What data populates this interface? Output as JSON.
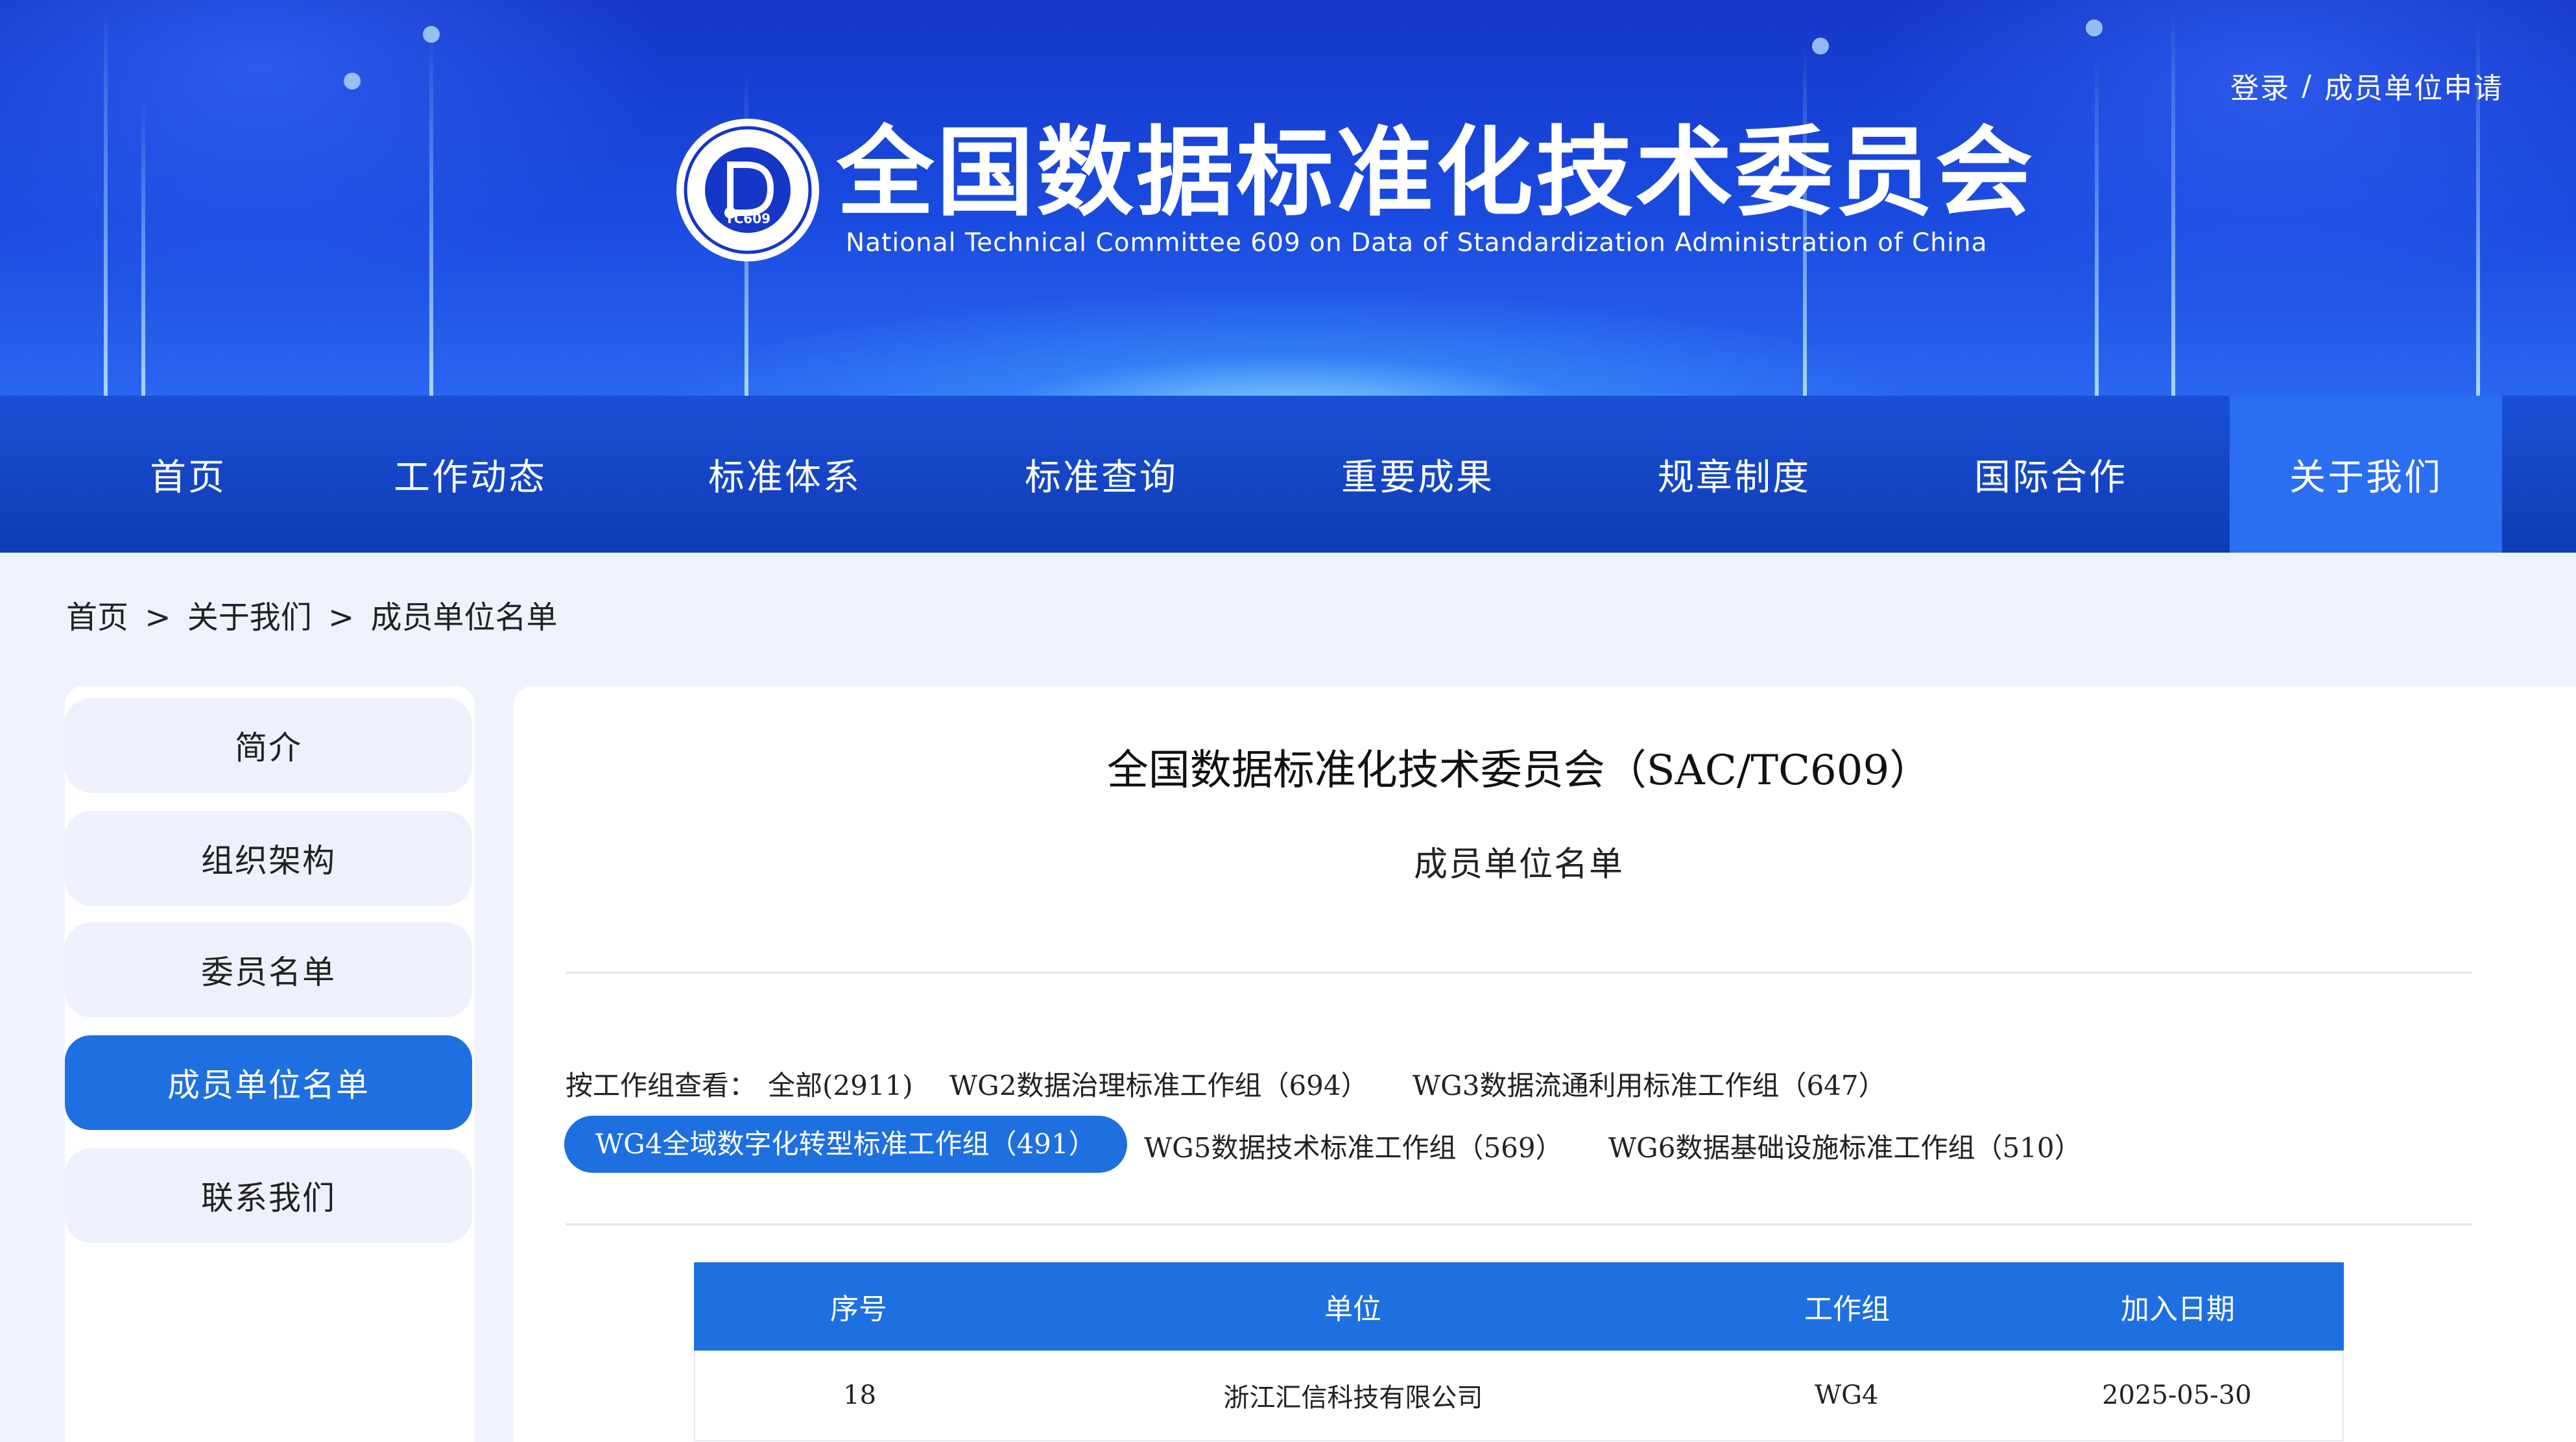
{
  "header": {
    "site_title": "全国数据标准化技术委员会",
    "site_subtitle": "National Technical Committee 609 on Data of Standardization Administration of China",
    "login_link": "登录",
    "link_separator": "/",
    "apply_link": "成员单位申请",
    "seal_badge": "TC609"
  },
  "nav": {
    "items": [
      "首页",
      "工作动态",
      "标准体系",
      "标准查询",
      "重要成果",
      "规章制度",
      "国际合作",
      "关于我们"
    ],
    "active": "关于我们"
  },
  "breadcrumb": {
    "home": "首页",
    "sep": ">",
    "parent": "关于我们",
    "current": "成员单位名单"
  },
  "sidebar": {
    "items": [
      "简介",
      "组织架构",
      "委员名单",
      "成员单位名单",
      "联系我们"
    ],
    "active": "成员单位名单"
  },
  "main": {
    "title": "全国数据标准化技术委员会（SAC/TC609）",
    "subtitle": "成员单位名单",
    "filter_label": "按工作组查看：",
    "filters": [
      "全部(2911)",
      "WG2数据治理标准工作组（694）",
      "WG3数据流通利用标准工作组（647）",
      "WG4全域数字化转型标准工作组（491）",
      "WG5数据技术标准工作组（569）",
      "WG6数据基础设施标准工作组（510）"
    ],
    "active_filter": "WG4全域数字化转型标准工作组（491）"
  },
  "table": {
    "headers": [
      "序号",
      "单位",
      "工作组",
      "加入日期"
    ],
    "rows": [
      [
        "18",
        "浙江汇信科技有限公司",
        "WG4",
        "2025-05-30"
      ]
    ]
  },
  "colors": {
    "nav_bg": "#0f3cb4",
    "accent": "#1e6fe0",
    "nav_active": "#2a6ef2"
  }
}
